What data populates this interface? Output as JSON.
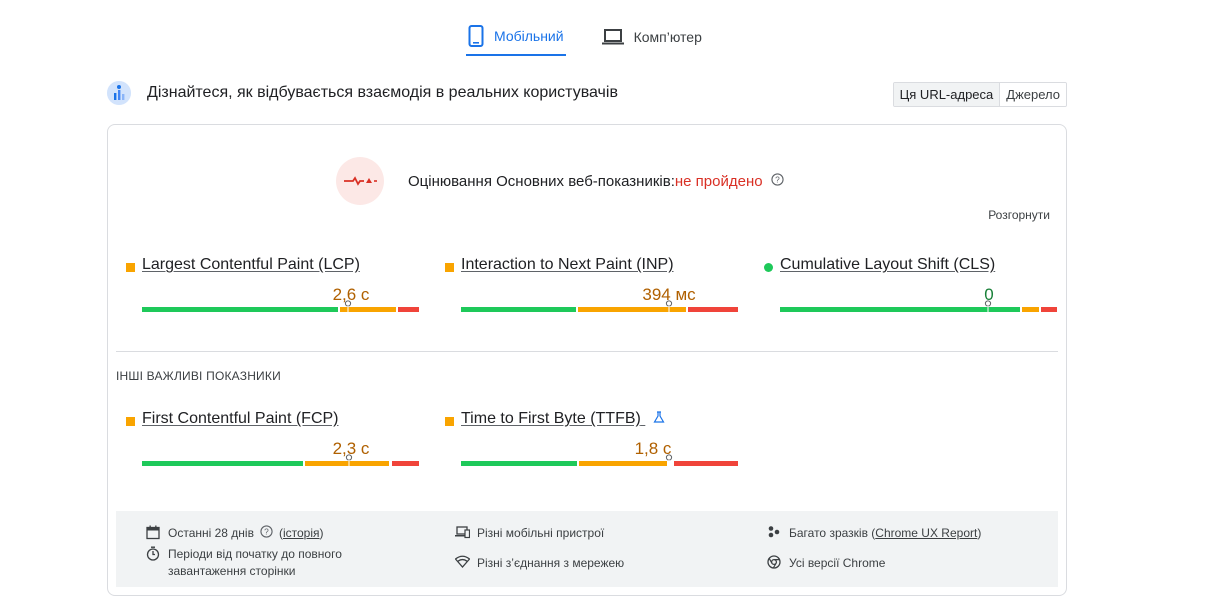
{
  "tabs": [
    {
      "label": "Мобільний",
      "active": true,
      "icon": "smartphone-icon"
    },
    {
      "label": "Комп’ютер",
      "active": false,
      "icon": "laptop-icon"
    }
  ],
  "section": {
    "title": "Дізнайтеся, як відбувається взаємодія в реальних користувачів",
    "toggle": [
      "Ця URL-адреса",
      "Джерело"
    ]
  },
  "assessment": {
    "label": "Оцінювання Основних веб-показників:",
    "status": "не пройдено",
    "expand": "Розгорнути"
  },
  "colors": {
    "good": "#1ec95a",
    "needs_improvement": "#f9a400",
    "poor": "#f0443a",
    "fail": "#d93025",
    "accent": "#1a73e8"
  },
  "core_metrics": [
    {
      "name": "Largest Contentful Paint (LCP)",
      "value": "2,6 с",
      "rating": "needs-improvement",
      "position": 0.74
    },
    {
      "name": "Interaction to Next Paint (INP)",
      "value": "394 мс",
      "rating": "needs-improvement",
      "position": 0.75
    },
    {
      "name": "Cumulative Layout Shift (CLS)",
      "value": "0",
      "rating": "good",
      "position": 0.75
    }
  ],
  "other_label": "ІНШІ ВАЖЛИВІ ПОКАЗНИКИ",
  "other_metrics": [
    {
      "name": "First Contentful Paint (FCP)",
      "value": "2,3 с",
      "rating": "needs-improvement",
      "position": 0.74
    },
    {
      "name": "Time to First Byte (TTFB)",
      "value": "1,8 с",
      "rating": "needs-improvement",
      "position": 0.75,
      "experimental": true
    }
  ],
  "footer": {
    "period": "Останні 28 днів",
    "history_link": "історія",
    "duration": "Періоди від початку до повного завантаження сторінки",
    "devices": "Різні мобільні пристрої",
    "network": "Різні з’єднання з мережею",
    "samples_prefix": "Багато зразків (",
    "samples_link": "Chrome UX Report",
    "samples_suffix": ")",
    "chrome": "Усі версії Chrome"
  }
}
